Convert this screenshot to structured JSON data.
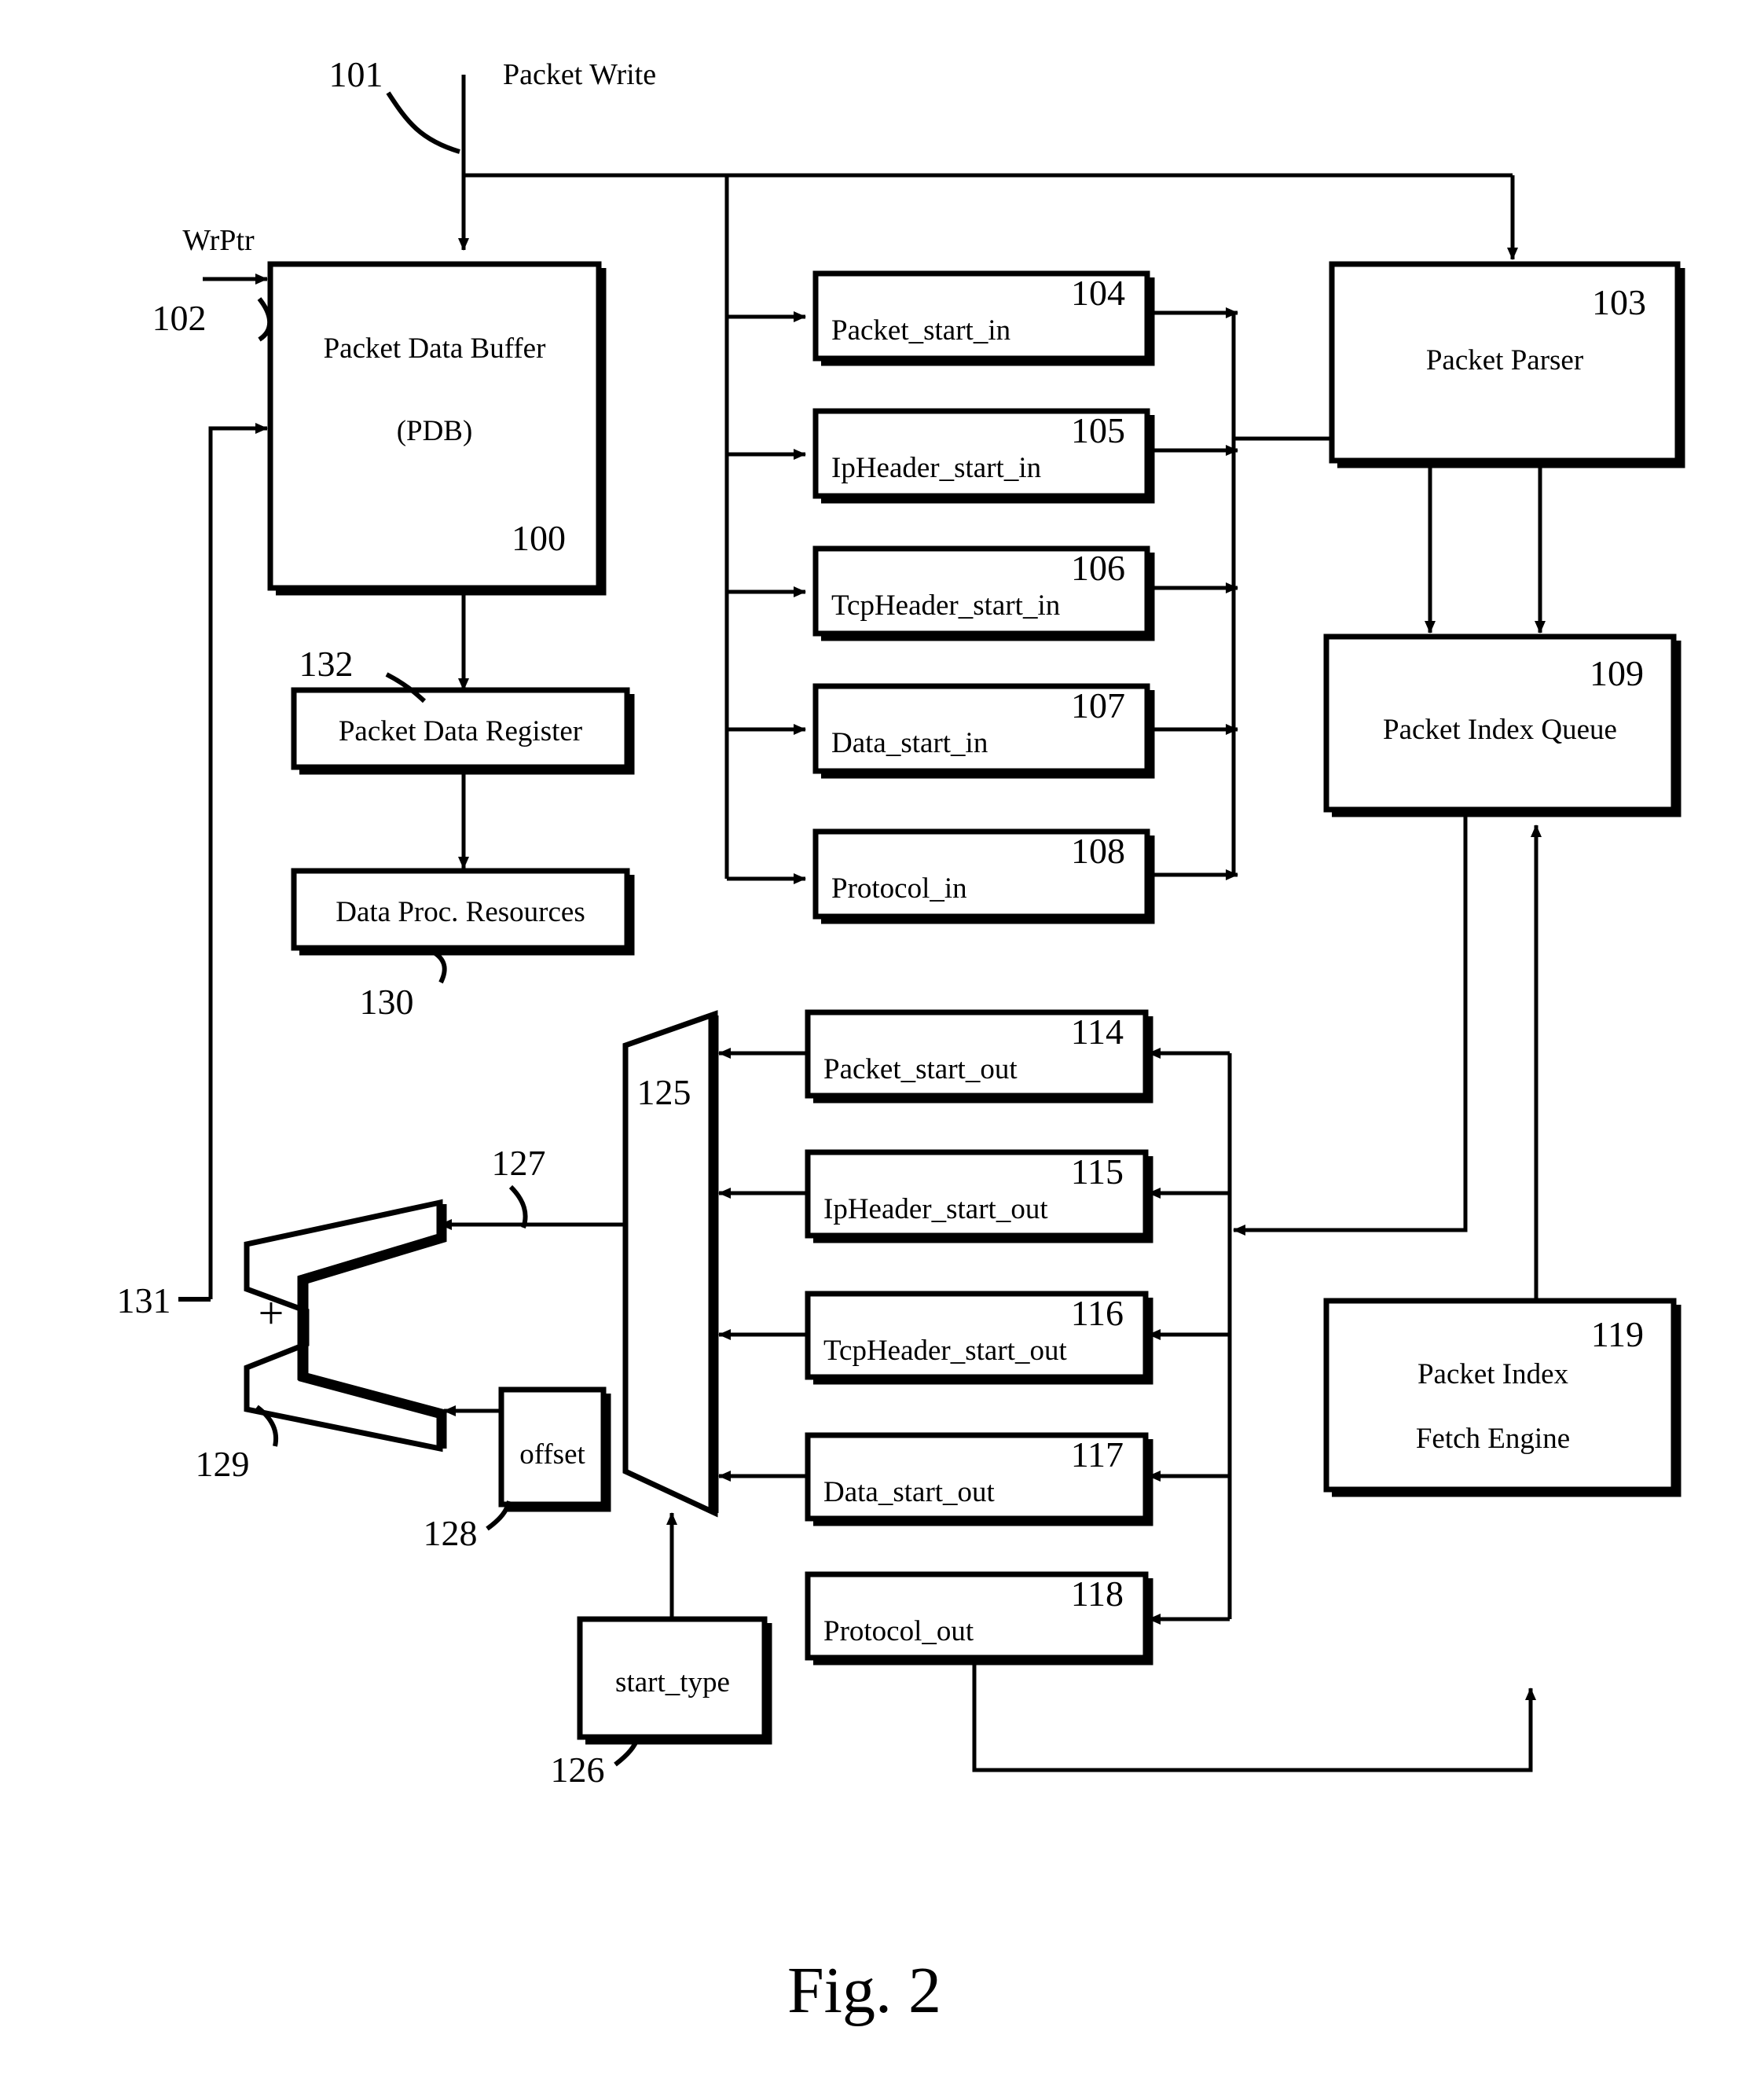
{
  "figure": {
    "caption": "Fig. 2",
    "title_signal": "Packet Write",
    "wrptr_label": "WrPtr"
  },
  "blocks": [
    {
      "id": "100",
      "label_line1": "Packet Data Buffer",
      "label_line2": "(PDB)",
      "ref": "100"
    },
    {
      "id": "103",
      "label_line1": "Packet Parser",
      "label_line2": "",
      "ref": "103"
    },
    {
      "id": "104",
      "label_line1": "Packet_start_in",
      "label_line2": "",
      "ref": "104"
    },
    {
      "id": "105",
      "label_line1": "IpHeader_start_in",
      "label_line2": "",
      "ref": "105"
    },
    {
      "id": "106",
      "label_line1": "TcpHeader_start_in",
      "label_line2": "",
      "ref": "106"
    },
    {
      "id": "107",
      "label_line1": "Data_start_in",
      "label_line2": "",
      "ref": "107"
    },
    {
      "id": "108",
      "label_line1": "Protocol_in",
      "label_line2": "",
      "ref": "108"
    },
    {
      "id": "109",
      "label_line1": "Packet Index Queue",
      "label_line2": "",
      "ref": "109"
    },
    {
      "id": "114",
      "label_line1": "Packet_start_out",
      "label_line2": "",
      "ref": "114"
    },
    {
      "id": "115",
      "label_line1": "IpHeader_start_out",
      "label_line2": "",
      "ref": "115"
    },
    {
      "id": "116",
      "label_line1": "TcpHeader_start_out",
      "label_line2": "",
      "ref": "116"
    },
    {
      "id": "117",
      "label_line1": "Data_start_out",
      "label_line2": "",
      "ref": "117"
    },
    {
      "id": "118",
      "label_line1": "Protocol_out",
      "label_line2": "",
      "ref": "118"
    },
    {
      "id": "119",
      "label_line1": "Packet Index",
      "label_line2": "Fetch Engine",
      "ref": "119"
    },
    {
      "id": "126",
      "label_line1": "start_type",
      "label_line2": "",
      "ref": "126"
    },
    {
      "id": "128",
      "label_line1": "offset",
      "label_line2": "",
      "ref": "128"
    },
    {
      "id": "130",
      "label_line1": "Data Proc. Resources",
      "label_line2": "",
      "ref": "130"
    },
    {
      "id": "132",
      "label_line1": "Packet Data Register",
      "label_line2": "",
      "ref": "132"
    }
  ],
  "refs": {
    "r100": "100",
    "r101": "101",
    "r102": "102",
    "r103": "103",
    "r104": "104",
    "r105": "105",
    "r106": "106",
    "r107": "107",
    "r108": "108",
    "r109": "109",
    "r114": "114",
    "r115": "115",
    "r116": "116",
    "r117": "117",
    "r118": "118",
    "r119": "119",
    "r125": "125",
    "r126": "126",
    "r127": "127",
    "r128": "128",
    "r129": "129",
    "r130": "130",
    "r131": "131",
    "r132": "132"
  },
  "texts": {
    "pdb_l1": "Packet Data Buffer",
    "pdb_l2": "(PDB)",
    "packet_parser": "Packet Parser",
    "packet_start_in": "Packet_start_in",
    "ipheader_start_in": "IpHeader_start_in",
    "tcpheader_start_in": "TcpHeader_start_in",
    "data_start_in": "Data_start_in",
    "protocol_in": "Protocol_in",
    "packet_index_queue": "Packet Index Queue",
    "packet_data_register": "Packet Data Register",
    "data_proc_resources": "Data Proc. Resources",
    "packet_start_out": "Packet_start_out",
    "ipheader_start_out": "IpHeader_start_out",
    "tcpheader_start_out": "TcpHeader_start_out",
    "data_start_out": "Data_start_out",
    "protocol_out": "Protocol_out",
    "pife_l1": "Packet Index",
    "pife_l2": "Fetch Engine",
    "start_type": "start_type",
    "offset": "offset",
    "packet_write": "Packet Write",
    "wrptr": "WrPtr",
    "plus": "+",
    "caption": "Fig. 2"
  }
}
